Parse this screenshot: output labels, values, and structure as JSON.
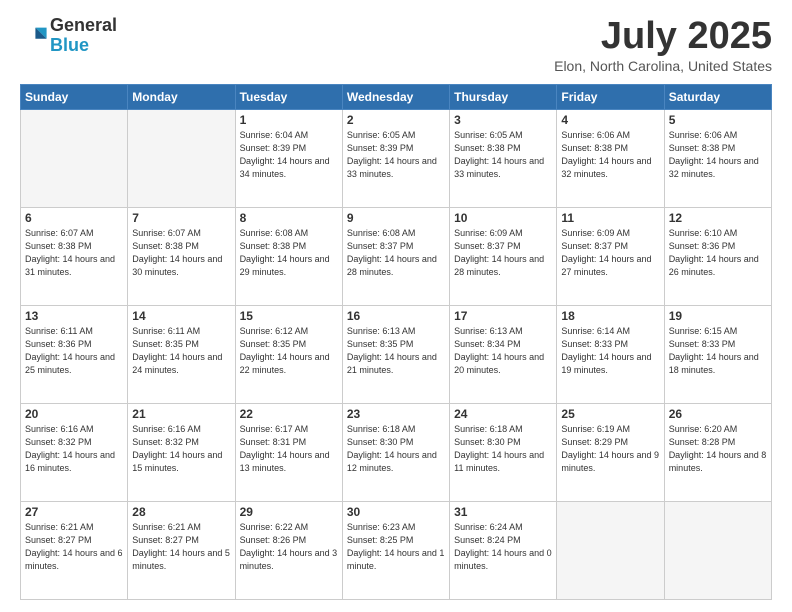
{
  "header": {
    "logo_general": "General",
    "logo_blue": "Blue",
    "month_title": "July 2025",
    "location": "Elon, North Carolina, United States"
  },
  "weekdays": [
    "Sunday",
    "Monday",
    "Tuesday",
    "Wednesday",
    "Thursday",
    "Friday",
    "Saturday"
  ],
  "weeks": [
    [
      {
        "day": "",
        "sunrise": "",
        "sunset": "",
        "daylight": ""
      },
      {
        "day": "",
        "sunrise": "",
        "sunset": "",
        "daylight": ""
      },
      {
        "day": "1",
        "sunrise": "Sunrise: 6:04 AM",
        "sunset": "Sunset: 8:39 PM",
        "daylight": "Daylight: 14 hours and 34 minutes."
      },
      {
        "day": "2",
        "sunrise": "Sunrise: 6:05 AM",
        "sunset": "Sunset: 8:39 PM",
        "daylight": "Daylight: 14 hours and 33 minutes."
      },
      {
        "day": "3",
        "sunrise": "Sunrise: 6:05 AM",
        "sunset": "Sunset: 8:38 PM",
        "daylight": "Daylight: 14 hours and 33 minutes."
      },
      {
        "day": "4",
        "sunrise": "Sunrise: 6:06 AM",
        "sunset": "Sunset: 8:38 PM",
        "daylight": "Daylight: 14 hours and 32 minutes."
      },
      {
        "day": "5",
        "sunrise": "Sunrise: 6:06 AM",
        "sunset": "Sunset: 8:38 PM",
        "daylight": "Daylight: 14 hours and 32 minutes."
      }
    ],
    [
      {
        "day": "6",
        "sunrise": "Sunrise: 6:07 AM",
        "sunset": "Sunset: 8:38 PM",
        "daylight": "Daylight: 14 hours and 31 minutes."
      },
      {
        "day": "7",
        "sunrise": "Sunrise: 6:07 AM",
        "sunset": "Sunset: 8:38 PM",
        "daylight": "Daylight: 14 hours and 30 minutes."
      },
      {
        "day": "8",
        "sunrise": "Sunrise: 6:08 AM",
        "sunset": "Sunset: 8:38 PM",
        "daylight": "Daylight: 14 hours and 29 minutes."
      },
      {
        "day": "9",
        "sunrise": "Sunrise: 6:08 AM",
        "sunset": "Sunset: 8:37 PM",
        "daylight": "Daylight: 14 hours and 28 minutes."
      },
      {
        "day": "10",
        "sunrise": "Sunrise: 6:09 AM",
        "sunset": "Sunset: 8:37 PM",
        "daylight": "Daylight: 14 hours and 28 minutes."
      },
      {
        "day": "11",
        "sunrise": "Sunrise: 6:09 AM",
        "sunset": "Sunset: 8:37 PM",
        "daylight": "Daylight: 14 hours and 27 minutes."
      },
      {
        "day": "12",
        "sunrise": "Sunrise: 6:10 AM",
        "sunset": "Sunset: 8:36 PM",
        "daylight": "Daylight: 14 hours and 26 minutes."
      }
    ],
    [
      {
        "day": "13",
        "sunrise": "Sunrise: 6:11 AM",
        "sunset": "Sunset: 8:36 PM",
        "daylight": "Daylight: 14 hours and 25 minutes."
      },
      {
        "day": "14",
        "sunrise": "Sunrise: 6:11 AM",
        "sunset": "Sunset: 8:35 PM",
        "daylight": "Daylight: 14 hours and 24 minutes."
      },
      {
        "day": "15",
        "sunrise": "Sunrise: 6:12 AM",
        "sunset": "Sunset: 8:35 PM",
        "daylight": "Daylight: 14 hours and 22 minutes."
      },
      {
        "day": "16",
        "sunrise": "Sunrise: 6:13 AM",
        "sunset": "Sunset: 8:35 PM",
        "daylight": "Daylight: 14 hours and 21 minutes."
      },
      {
        "day": "17",
        "sunrise": "Sunrise: 6:13 AM",
        "sunset": "Sunset: 8:34 PM",
        "daylight": "Daylight: 14 hours and 20 minutes."
      },
      {
        "day": "18",
        "sunrise": "Sunrise: 6:14 AM",
        "sunset": "Sunset: 8:33 PM",
        "daylight": "Daylight: 14 hours and 19 minutes."
      },
      {
        "day": "19",
        "sunrise": "Sunrise: 6:15 AM",
        "sunset": "Sunset: 8:33 PM",
        "daylight": "Daylight: 14 hours and 18 minutes."
      }
    ],
    [
      {
        "day": "20",
        "sunrise": "Sunrise: 6:16 AM",
        "sunset": "Sunset: 8:32 PM",
        "daylight": "Daylight: 14 hours and 16 minutes."
      },
      {
        "day": "21",
        "sunrise": "Sunrise: 6:16 AM",
        "sunset": "Sunset: 8:32 PM",
        "daylight": "Daylight: 14 hours and 15 minutes."
      },
      {
        "day": "22",
        "sunrise": "Sunrise: 6:17 AM",
        "sunset": "Sunset: 8:31 PM",
        "daylight": "Daylight: 14 hours and 13 minutes."
      },
      {
        "day": "23",
        "sunrise": "Sunrise: 6:18 AM",
        "sunset": "Sunset: 8:30 PM",
        "daylight": "Daylight: 14 hours and 12 minutes."
      },
      {
        "day": "24",
        "sunrise": "Sunrise: 6:18 AM",
        "sunset": "Sunset: 8:30 PM",
        "daylight": "Daylight: 14 hours and 11 minutes."
      },
      {
        "day": "25",
        "sunrise": "Sunrise: 6:19 AM",
        "sunset": "Sunset: 8:29 PM",
        "daylight": "Daylight: 14 hours and 9 minutes."
      },
      {
        "day": "26",
        "sunrise": "Sunrise: 6:20 AM",
        "sunset": "Sunset: 8:28 PM",
        "daylight": "Daylight: 14 hours and 8 minutes."
      }
    ],
    [
      {
        "day": "27",
        "sunrise": "Sunrise: 6:21 AM",
        "sunset": "Sunset: 8:27 PM",
        "daylight": "Daylight: 14 hours and 6 minutes."
      },
      {
        "day": "28",
        "sunrise": "Sunrise: 6:21 AM",
        "sunset": "Sunset: 8:27 PM",
        "daylight": "Daylight: 14 hours and 5 minutes."
      },
      {
        "day": "29",
        "sunrise": "Sunrise: 6:22 AM",
        "sunset": "Sunset: 8:26 PM",
        "daylight": "Daylight: 14 hours and 3 minutes."
      },
      {
        "day": "30",
        "sunrise": "Sunrise: 6:23 AM",
        "sunset": "Sunset: 8:25 PM",
        "daylight": "Daylight: 14 hours and 1 minute."
      },
      {
        "day": "31",
        "sunrise": "Sunrise: 6:24 AM",
        "sunset": "Sunset: 8:24 PM",
        "daylight": "Daylight: 14 hours and 0 minutes."
      },
      {
        "day": "",
        "sunrise": "",
        "sunset": "",
        "daylight": ""
      },
      {
        "day": "",
        "sunrise": "",
        "sunset": "",
        "daylight": ""
      }
    ]
  ]
}
